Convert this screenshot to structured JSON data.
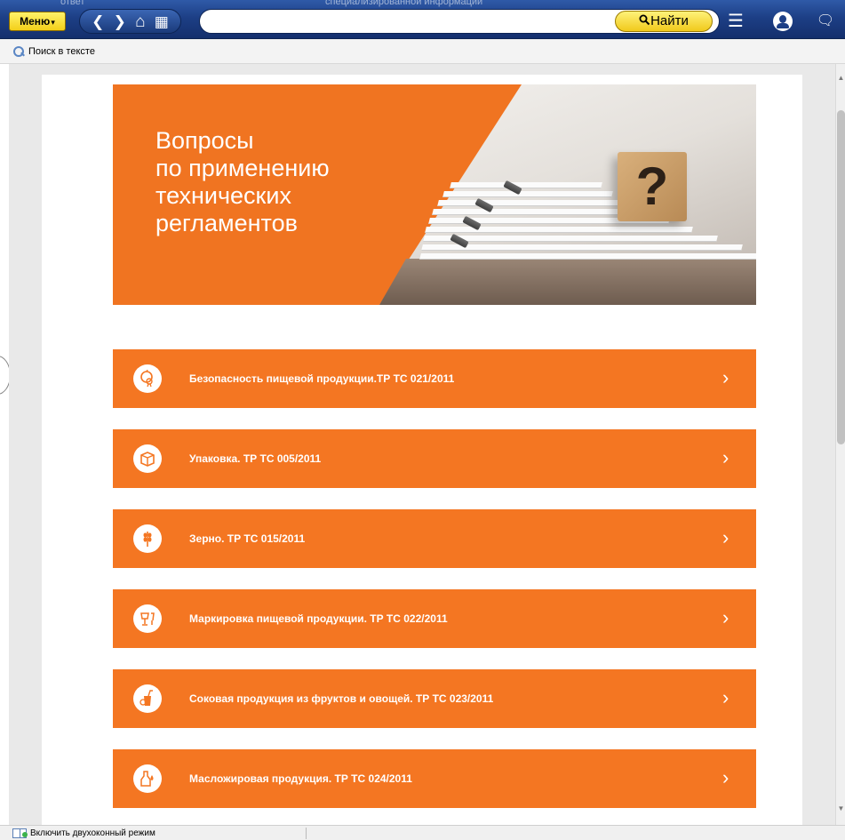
{
  "toolbar": {
    "menu_label": "Меню",
    "menu_caret": "▾",
    "ghost_left": "ответ",
    "ghost_right": "специализированной информации",
    "nav": {
      "back": "❮",
      "forward": "❯",
      "home": "⌂",
      "grid": "▦"
    },
    "search_placeholder": "",
    "find_label": "Найти",
    "find_icon": "magnifier-icon",
    "list_icon": "☰",
    "user_icon": "user-icon",
    "chat_icon": "🗨"
  },
  "subbar": {
    "find_in_text": "Поиск в тексте"
  },
  "banner": {
    "title_lines": [
      "Вопросы",
      "по применению",
      "технических",
      "регламентов"
    ],
    "cube_mark": "?"
  },
  "categories": [
    {
      "label": "Безопасность пищевой продукции.ТР ТС 021/2011",
      "icon": "food-safety-icon"
    },
    {
      "label": "Упаковка. ТР ТС 005/2011",
      "icon": "package-icon"
    },
    {
      "label": "Зерно. ТР ТС 015/2011",
      "icon": "grain-icon"
    },
    {
      "label": "Маркировка пищевой продукции. ТР ТС 022/2011",
      "icon": "labeling-icon"
    },
    {
      "label": "Соковая продукция из фруктов и овощей. ТР ТС 023/2011",
      "icon": "juice-icon"
    },
    {
      "label": "Масложировая продукция. ТР ТС 024/2011",
      "icon": "oil-fat-icon"
    }
  ],
  "chevron": "›",
  "statusbar": {
    "dual_mode": "Включить двухоконный режим"
  },
  "colors": {
    "toolbar": "#1d3f86",
    "accent_orange": "#f47622",
    "find_yellow": "#f3cf19"
  }
}
